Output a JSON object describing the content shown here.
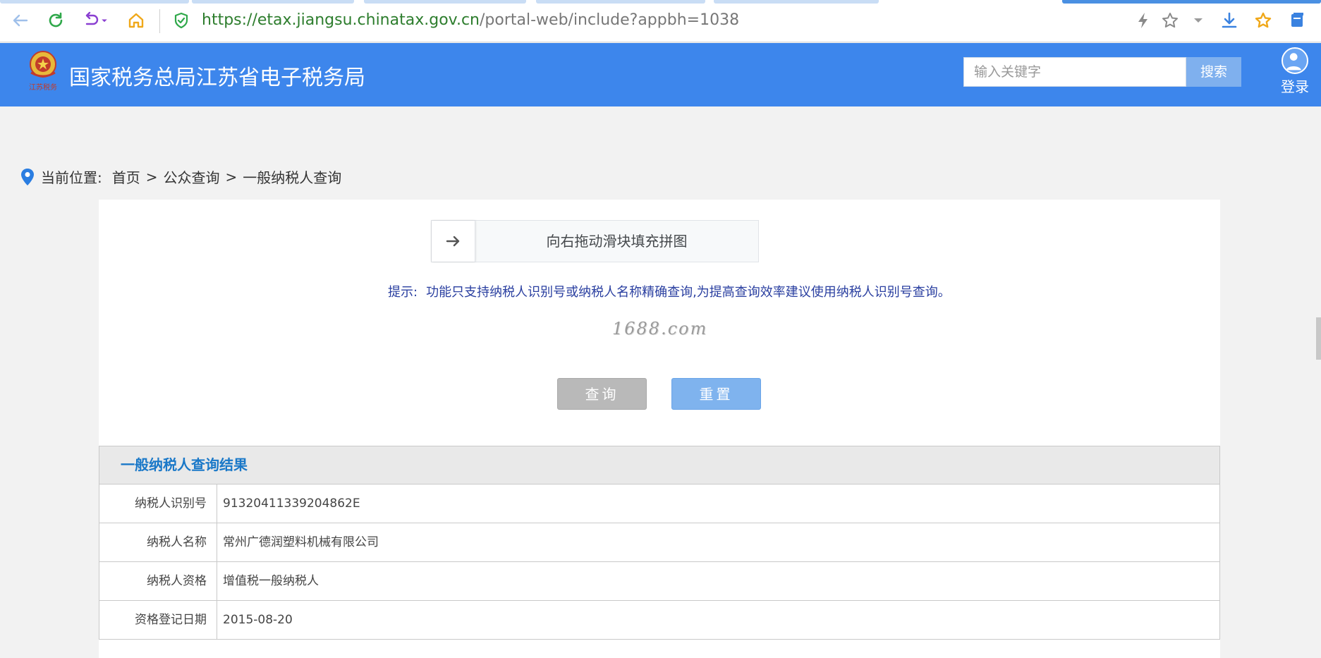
{
  "browser": {
    "url_prefix": "https://",
    "url_host": "etax.jiangsu.chinatax.gov.cn",
    "url_path": "/portal-web/include?appbh=1038",
    "icons": [
      "back-icon",
      "refresh-icon",
      "undo-icon",
      "home-icon",
      "shield-icon",
      "lightning-icon",
      "star-icon",
      "dropdown-icon",
      "download-icon",
      "favorites-icon",
      "collections-icon"
    ]
  },
  "header": {
    "logo_text": "江苏税务",
    "title": "国家税务总局江苏省电子税务局",
    "search_placeholder": "输入关键字",
    "search_button": "搜索",
    "login_label": "登录"
  },
  "breadcrumb": {
    "prefix": "当前位置:",
    "items": [
      "首页",
      "公众查询",
      "一般纳税人查询"
    ],
    "separator": ">"
  },
  "form": {
    "slider_hint": "向右拖动滑块填充拼图",
    "tip_label": "提示:",
    "tip_text": "功能只支持纳税人识别号或纳税人名称精确查询,为提高查询效率建议使用纳税人识别号查询。",
    "watermark": "1688.com",
    "query_button": "查询",
    "reset_button": "重置"
  },
  "result": {
    "title": "一般纳税人查询结果",
    "rows": [
      {
        "key": "纳税人识别号",
        "value": "91320411339204862E"
      },
      {
        "key": "纳税人名称",
        "value": "常州广德润塑料机械有限公司"
      },
      {
        "key": "纳税人资格",
        "value": "增值税一般纳税人"
      },
      {
        "key": "资格登记日期",
        "value": "2015-08-20"
      }
    ]
  },
  "colors": {
    "header_bg": "#3d86ec",
    "result_title": "#1a78c8",
    "tip_text": "#2a3fa0"
  }
}
